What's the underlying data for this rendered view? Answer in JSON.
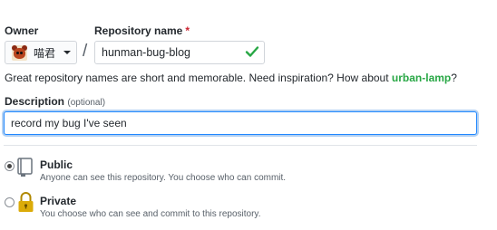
{
  "owner": {
    "label": "Owner",
    "selected": "喵君",
    "avatar_icon": "panda-avatar"
  },
  "repository": {
    "label": "Repository name",
    "required_marker": "*",
    "value": "hunman-bug-blog",
    "valid": true,
    "check_color": "#28a745"
  },
  "separator": "/",
  "hint": {
    "text": "Great repository names are short and memorable. Need inspiration? How about",
    "suggestion": "urban-lamp",
    "suffix": "?"
  },
  "description": {
    "label": "Description",
    "optional": "(optional)",
    "value": "record my bug I've seen"
  },
  "visibility": {
    "selected": "public",
    "options": [
      {
        "id": "public",
        "title": "Public",
        "description": "Anyone can see this repository. You choose who can commit.",
        "icon": "repo-book-icon"
      },
      {
        "id": "private",
        "title": "Private",
        "description": "You choose who can see and commit to this repository.",
        "icon": "lock-icon"
      }
    ]
  }
}
